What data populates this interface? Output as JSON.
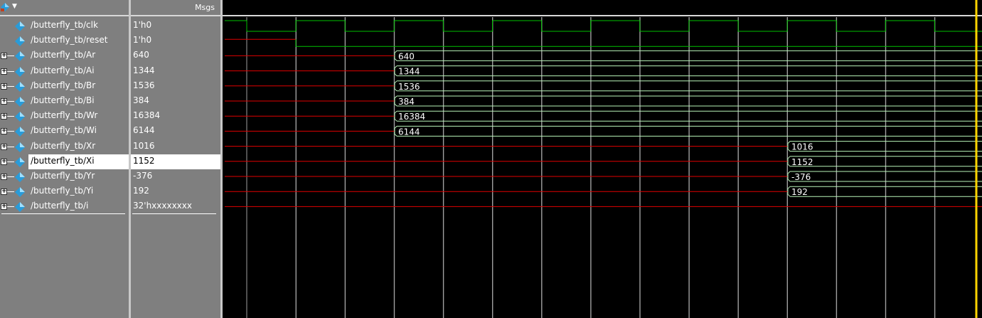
{
  "header": {
    "msgs_label": "Msgs",
    "toolbar_icon": "waveform-icon",
    "dropdown_icon": "chevron-down-icon"
  },
  "signals": [
    {
      "name": "/butterfly_tb/clk",
      "value": "1'h0",
      "expandable": false,
      "kind": "clock"
    },
    {
      "name": "/butterfly_tb/reset",
      "value": "1'h0",
      "expandable": false,
      "kind": "reset"
    },
    {
      "name": "/butterfly_tb/Ar",
      "value": "640",
      "expandable": true,
      "kind": "bus",
      "wave_label": "640",
      "change_cycle": 4
    },
    {
      "name": "/butterfly_tb/Ai",
      "value": "1344",
      "expandable": true,
      "kind": "bus",
      "wave_label": "1344",
      "change_cycle": 4
    },
    {
      "name": "/butterfly_tb/Br",
      "value": "1536",
      "expandable": true,
      "kind": "bus",
      "wave_label": "1536",
      "change_cycle": 4
    },
    {
      "name": "/butterfly_tb/Bi",
      "value": "384",
      "expandable": true,
      "kind": "bus",
      "wave_label": "384",
      "change_cycle": 4
    },
    {
      "name": "/butterfly_tb/Wr",
      "value": "16384",
      "expandable": true,
      "kind": "bus",
      "wave_label": "16384",
      "change_cycle": 4
    },
    {
      "name": "/butterfly_tb/Wi",
      "value": "6144",
      "expandable": true,
      "kind": "bus",
      "wave_label": "6144",
      "change_cycle": 4
    },
    {
      "name": "/butterfly_tb/Xr",
      "value": "1016",
      "expandable": true,
      "kind": "bus",
      "wave_label": "1016",
      "change_cycle": 12
    },
    {
      "name": "/butterfly_tb/Xi",
      "value": "1152",
      "expandable": true,
      "kind": "bus",
      "wave_label": "1152",
      "change_cycle": 12,
      "selected": true
    },
    {
      "name": "/butterfly_tb/Yr",
      "value": "-376",
      "expandable": true,
      "kind": "bus",
      "wave_label": "-376",
      "change_cycle": 12
    },
    {
      "name": "/butterfly_tb/Yi",
      "value": "192",
      "expandable": true,
      "kind": "bus",
      "wave_label": "192",
      "change_cycle": 12
    },
    {
      "name": "/butterfly_tb/i",
      "value": "32'hxxxxxxxx",
      "expandable": true,
      "kind": "unknown"
    }
  ],
  "colors": {
    "pane_bg": "#7f7f7f",
    "wave_bg": "#000000",
    "valid_wave": "#b8f4b8",
    "clock_wave": "#00c000",
    "unknown_wave": "#e00000",
    "gridline": "#a0a0a0",
    "cursor": "#ffd400",
    "signal_icon": "#2a9bd8"
  }
}
